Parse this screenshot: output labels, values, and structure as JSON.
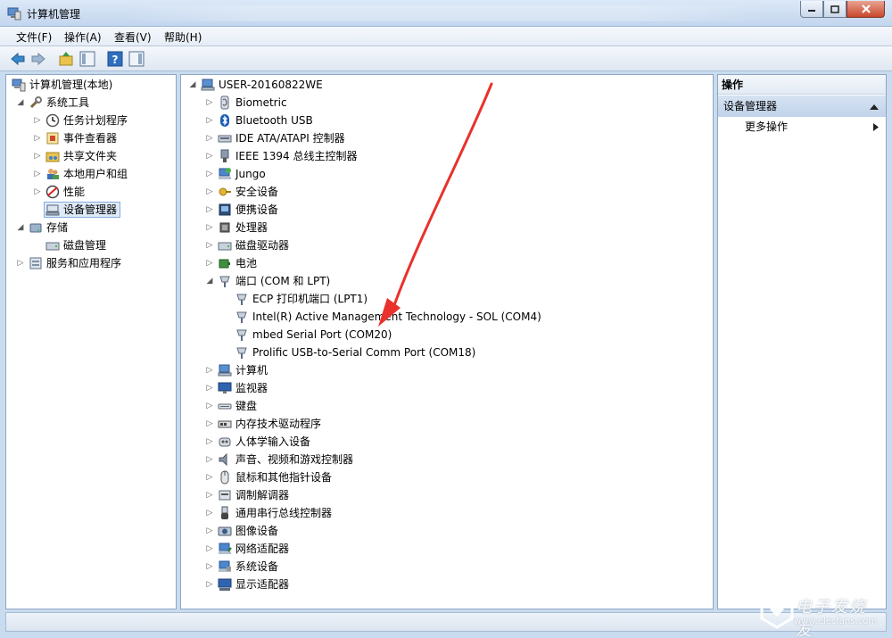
{
  "window": {
    "title": "计算机管理"
  },
  "menu": [
    "文件(F)",
    "操作(A)",
    "查看(V)",
    "帮助(H)"
  ],
  "left_tree": [
    {
      "label": "计算机管理(本地)",
      "icon": "computer-manage-icon",
      "exp": "",
      "level": 0
    },
    {
      "label": "系统工具",
      "icon": "tools-icon",
      "exp": "open",
      "level": 1
    },
    {
      "label": "任务计划程序",
      "icon": "clock-icon",
      "exp": "closed",
      "level": 2
    },
    {
      "label": "事件查看器",
      "icon": "event-viewer-icon",
      "exp": "closed",
      "level": 2
    },
    {
      "label": "共享文件夹",
      "icon": "shared-folder-icon",
      "exp": "closed",
      "level": 2
    },
    {
      "label": "本地用户和组",
      "icon": "users-icon",
      "exp": "closed",
      "level": 2
    },
    {
      "label": "性能",
      "icon": "performance-icon",
      "exp": "closed",
      "level": 2
    },
    {
      "label": "设备管理器",
      "icon": "device-manager-icon",
      "exp": "",
      "level": 2,
      "selected": true
    },
    {
      "label": "存储",
      "icon": "storage-icon",
      "exp": "open",
      "level": 1
    },
    {
      "label": "磁盘管理",
      "icon": "disk-manage-icon",
      "exp": "",
      "level": 2
    },
    {
      "label": "服务和应用程序",
      "icon": "services-icon",
      "exp": "closed",
      "level": 1
    }
  ],
  "device_tree": [
    {
      "label": "USER-20160822WE",
      "icon": "computer-icon",
      "exp": "open",
      "level": 0
    },
    {
      "label": "Biometric",
      "icon": "biometric-icon",
      "exp": "closed",
      "level": 1
    },
    {
      "label": "Bluetooth USB",
      "icon": "bluetooth-icon",
      "exp": "closed",
      "level": 1
    },
    {
      "label": "IDE ATA/ATAPI 控制器",
      "icon": "ide-controller-icon",
      "exp": "closed",
      "level": 1
    },
    {
      "label": "IEEE 1394 总线主控制器",
      "icon": "ieee1394-icon",
      "exp": "closed",
      "level": 1
    },
    {
      "label": "Jungo",
      "icon": "jungo-icon",
      "exp": "closed",
      "level": 1
    },
    {
      "label": "安全设备",
      "icon": "security-device-icon",
      "exp": "closed",
      "level": 1
    },
    {
      "label": "便携设备",
      "icon": "portable-device-icon",
      "exp": "closed",
      "level": 1
    },
    {
      "label": "处理器",
      "icon": "processor-icon",
      "exp": "closed",
      "level": 1
    },
    {
      "label": "磁盘驱动器",
      "icon": "disk-drive-icon",
      "exp": "closed",
      "level": 1
    },
    {
      "label": "电池",
      "icon": "battery-icon",
      "exp": "closed",
      "level": 1
    },
    {
      "label": "端口 (COM 和 LPT)",
      "icon": "port-icon",
      "exp": "open",
      "level": 1
    },
    {
      "label": "ECP 打印机端口 (LPT1)",
      "icon": "port-icon",
      "exp": "",
      "level": 2
    },
    {
      "label": "Intel(R) Active Management Technology - SOL (COM4)",
      "icon": "port-icon",
      "exp": "",
      "level": 2
    },
    {
      "label": "mbed Serial Port (COM20)",
      "icon": "port-icon",
      "exp": "",
      "level": 2
    },
    {
      "label": "Prolific USB-to-Serial Comm Port (COM18)",
      "icon": "port-icon",
      "exp": "",
      "level": 2
    },
    {
      "label": "计算机",
      "icon": "computer-icon",
      "exp": "closed",
      "level": 1
    },
    {
      "label": "监视器",
      "icon": "monitor-icon",
      "exp": "closed",
      "level": 1
    },
    {
      "label": "键盘",
      "icon": "keyboard-icon",
      "exp": "closed",
      "level": 1
    },
    {
      "label": "内存技术驱动程序",
      "icon": "memory-icon",
      "exp": "closed",
      "level": 1
    },
    {
      "label": "人体学输入设备",
      "icon": "hid-icon",
      "exp": "closed",
      "level": 1
    },
    {
      "label": "声音、视频和游戏控制器",
      "icon": "sound-icon",
      "exp": "closed",
      "level": 1
    },
    {
      "label": "鼠标和其他指针设备",
      "icon": "mouse-icon",
      "exp": "closed",
      "level": 1
    },
    {
      "label": "调制解调器",
      "icon": "modem-icon",
      "exp": "closed",
      "level": 1
    },
    {
      "label": "通用串行总线控制器",
      "icon": "usb-icon",
      "exp": "closed",
      "level": 1
    },
    {
      "label": "图像设备",
      "icon": "camera-icon",
      "exp": "closed",
      "level": 1
    },
    {
      "label": "网络适配器",
      "icon": "network-icon",
      "exp": "closed",
      "level": 1
    },
    {
      "label": "系统设备",
      "icon": "system-device-icon",
      "exp": "closed",
      "level": 1
    },
    {
      "label": "显示适配器",
      "icon": "display-adapter-icon",
      "exp": "closed",
      "level": 1
    }
  ],
  "actions": {
    "title": "操作",
    "section": "设备管理器",
    "more": "更多操作"
  },
  "watermark": {
    "text": "电子发烧友",
    "url": "www.elecfans.com"
  },
  "colors": {
    "accent": "#3c7fb1",
    "arrow": "#e8322b",
    "selection": "#dfeaf7"
  }
}
